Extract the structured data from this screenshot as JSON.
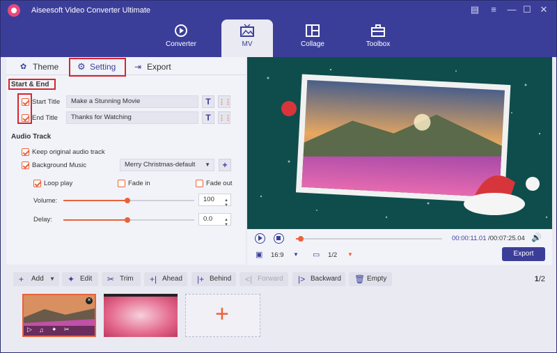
{
  "app": {
    "title": "Aiseesoft Video Converter Ultimate",
    "nav_tabs": [
      {
        "label": "Converter",
        "icon": "converter-icon"
      },
      {
        "label": "MV",
        "icon": "mv-icon"
      },
      {
        "label": "Collage",
        "icon": "collage-icon"
      },
      {
        "label": "Toolbox",
        "icon": "toolbox-icon"
      }
    ],
    "active_tab": "MV"
  },
  "subtabs": {
    "theme": "Theme",
    "setting": "Setting",
    "export": "Export"
  },
  "start_end": {
    "section_title": "Start & End",
    "start_label": "Start Title",
    "start_value": "Make a Stunning Movie",
    "end_label": "End Title",
    "end_value": "Thanks for Watching",
    "start_checked": true,
    "end_checked": true
  },
  "audio": {
    "section_title": "Audio Track",
    "keep_original": "Keep original audio track",
    "background_music": "Background Music",
    "music_selected": "Merry Christmas-default",
    "loop_play": "Loop play",
    "fade_in": "Fade in",
    "fade_out": "Fade out",
    "volume_label": "Volume:",
    "volume_value": "100",
    "delay_label": "Delay:",
    "delay_value": "0.0"
  },
  "player": {
    "current_time": "00:00:11.01",
    "total_time": "/00:07:25.04",
    "aspect_ratio": "16:9",
    "page": "1/2",
    "export_label": "Export"
  },
  "toolbar": {
    "add": "Add",
    "edit": "Edit",
    "trim": "Trim",
    "ahead": "Ahead",
    "behind": "Behind",
    "forward": "Forward",
    "backward": "Backward",
    "empty": "Empty",
    "page_current": "1",
    "page_total": "/2"
  },
  "colors": {
    "accent": "#3b3e99",
    "orange": "#e8623a",
    "highlight": "#d9232b"
  }
}
